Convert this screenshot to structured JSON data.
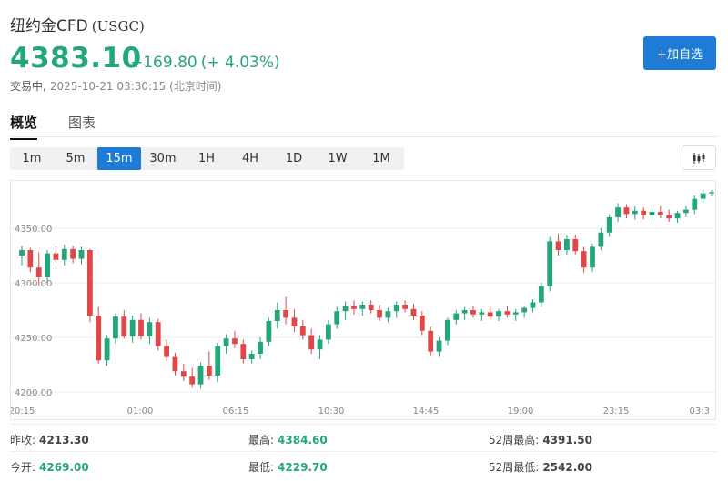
{
  "header": {
    "name": "纽约金CFD",
    "code": "(USGC)",
    "price": "4383.10",
    "change": "+169.80",
    "change_pct": "(+ 4.03%)",
    "status": "交易中,",
    "timestamp": "2025-10-21 03:30:15 (北京时间)",
    "add_button": "+加自选"
  },
  "tabs": [
    {
      "label": "概览",
      "active": true
    },
    {
      "label": "图表",
      "active": false
    }
  ],
  "intervals": [
    {
      "label": "1m",
      "active": false
    },
    {
      "label": "5m",
      "active": false
    },
    {
      "label": "15m",
      "active": true
    },
    {
      "label": "30m",
      "active": false
    },
    {
      "label": "1H",
      "active": false
    },
    {
      "label": "4H",
      "active": false
    },
    {
      "label": "1D",
      "active": false
    },
    {
      "label": "1W",
      "active": false
    },
    {
      "label": "1M",
      "active": false
    }
  ],
  "chart_type_icon": "candlestick-icon",
  "colors": {
    "up": "#23a67a",
    "down": "#e04848",
    "accent": "#1e7bd6"
  },
  "chart_data": {
    "type": "candlestick",
    "interval": "15m",
    "y_ticks": [
      4200,
      4250,
      4300,
      4350
    ],
    "y_tick_labels": [
      "4200.00",
      "4250.00",
      "4300.00",
      "4350.00"
    ],
    "ylim": [
      4195,
      4390
    ],
    "x_tick_labels": [
      "20:15",
      "01:00",
      "06:15",
      "10:30",
      "14:45",
      "19:00",
      "23:15",
      "03:3"
    ],
    "grid": true,
    "candles": [
      [
        4325,
        4334,
        4316,
        4330
      ],
      [
        4330,
        4332,
        4310,
        4314
      ],
      [
        4314,
        4328,
        4298,
        4305
      ],
      [
        4305,
        4330,
        4300,
        4327
      ],
      [
        4327,
        4333,
        4318,
        4321
      ],
      [
        4321,
        4335,
        4316,
        4331
      ],
      [
        4331,
        4334,
        4318,
        4322
      ],
      [
        4322,
        4333,
        4317,
        4330
      ],
      [
        4330,
        4331,
        4264,
        4270
      ],
      [
        4270,
        4278,
        4226,
        4229
      ],
      [
        4229,
        4252,
        4224,
        4249
      ],
      [
        4249,
        4272,
        4244,
        4269
      ],
      [
        4269,
        4275,
        4249,
        4251
      ],
      [
        4251,
        4270,
        4245,
        4266
      ],
      [
        4266,
        4272,
        4248,
        4251
      ],
      [
        4251,
        4268,
        4244,
        4264
      ],
      [
        4264,
        4267,
        4238,
        4242
      ],
      [
        4242,
        4248,
        4228,
        4232
      ],
      [
        4232,
        4236,
        4215,
        4219
      ],
      [
        4219,
        4226,
        4210,
        4214
      ],
      [
        4214,
        4222,
        4204,
        4207
      ],
      [
        4207,
        4227,
        4203,
        4224
      ],
      [
        4224,
        4237,
        4211,
        4215
      ],
      [
        4215,
        4245,
        4209,
        4242
      ],
      [
        4242,
        4253,
        4235,
        4249
      ],
      [
        4249,
        4256,
        4240,
        4244
      ],
      [
        4244,
        4248,
        4226,
        4230
      ],
      [
        4230,
        4238,
        4226,
        4235
      ],
      [
        4235,
        4250,
        4230,
        4246
      ],
      [
        4246,
        4268,
        4242,
        4265
      ],
      [
        4265,
        4282,
        4258,
        4275
      ],
      [
        4275,
        4287,
        4262,
        4268
      ],
      [
        4268,
        4276,
        4255,
        4260
      ],
      [
        4260,
        4266,
        4248,
        4252
      ],
      [
        4252,
        4258,
        4235,
        4239
      ],
      [
        4239,
        4252,
        4230,
        4248
      ],
      [
        4248,
        4266,
        4244,
        4262
      ],
      [
        4262,
        4278,
        4258,
        4274
      ],
      [
        4274,
        4283,
        4266,
        4279
      ],
      [
        4279,
        4284,
        4271,
        4276
      ],
      [
        4276,
        4283,
        4270,
        4280
      ],
      [
        4280,
        4284,
        4272,
        4275
      ],
      [
        4275,
        4280,
        4265,
        4268
      ],
      [
        4268,
        4277,
        4264,
        4274
      ],
      [
        4274,
        4283,
        4268,
        4280
      ],
      [
        4280,
        4284,
        4273,
        4276
      ],
      [
        4276,
        4281,
        4266,
        4270
      ],
      [
        4270,
        4274,
        4252,
        4256
      ],
      [
        4256,
        4260,
        4233,
        4237
      ],
      [
        4237,
        4250,
        4232,
        4247
      ],
      [
        4247,
        4268,
        4243,
        4266
      ],
      [
        4266,
        4275,
        4262,
        4272
      ],
      [
        4272,
        4278,
        4266,
        4275
      ],
      [
        4275,
        4279,
        4268,
        4271
      ],
      [
        4271,
        4276,
        4265,
        4273
      ],
      [
        4273,
        4278,
        4266,
        4269
      ],
      [
        4269,
        4276,
        4265,
        4274
      ],
      [
        4274,
        4279,
        4268,
        4271
      ],
      [
        4271,
        4276,
        4265,
        4273
      ],
      [
        4273,
        4279,
        4268,
        4277
      ],
      [
        4277,
        4285,
        4273,
        4282
      ],
      [
        4282,
        4300,
        4278,
        4297
      ],
      [
        4297,
        4342,
        4292,
        4338
      ],
      [
        4338,
        4345,
        4325,
        4330
      ],
      [
        4330,
        4343,
        4326,
        4340
      ],
      [
        4340,
        4344,
        4326,
        4329
      ],
      [
        4329,
        4333,
        4309,
        4314
      ],
      [
        4314,
        4336,
        4310,
        4333
      ],
      [
        4333,
        4350,
        4330,
        4346
      ],
      [
        4346,
        4363,
        4342,
        4360
      ],
      [
        4360,
        4373,
        4356,
        4369
      ],
      [
        4369,
        4372,
        4359,
        4363
      ],
      [
        4363,
        4370,
        4358,
        4366
      ],
      [
        4366,
        4369,
        4358,
        4362
      ],
      [
        4362,
        4368,
        4357,
        4365
      ],
      [
        4365,
        4370,
        4359,
        4362
      ],
      [
        4362,
        4367,
        4356,
        4359
      ],
      [
        4359,
        4366,
        4355,
        4364
      ],
      [
        4364,
        4370,
        4360,
        4367
      ],
      [
        4367,
        4380,
        4363,
        4377
      ],
      [
        4377,
        4385,
        4373,
        4382
      ],
      [
        4382,
        4385,
        4379,
        4383
      ]
    ]
  },
  "stats": [
    [
      {
        "label": "昨收:",
        "value": "4213.30",
        "up": false
      },
      {
        "label": "最高:",
        "value": "4384.60",
        "up": true
      },
      {
        "label": "52周最高:",
        "value": "4391.50",
        "up": false
      }
    ],
    [
      {
        "label": "今开:",
        "value": "4269.00",
        "up": true
      },
      {
        "label": "最低:",
        "value": "4229.70",
        "up": true
      },
      {
        "label": "52周最低:",
        "value": "2542.00",
        "up": false
      }
    ]
  ]
}
